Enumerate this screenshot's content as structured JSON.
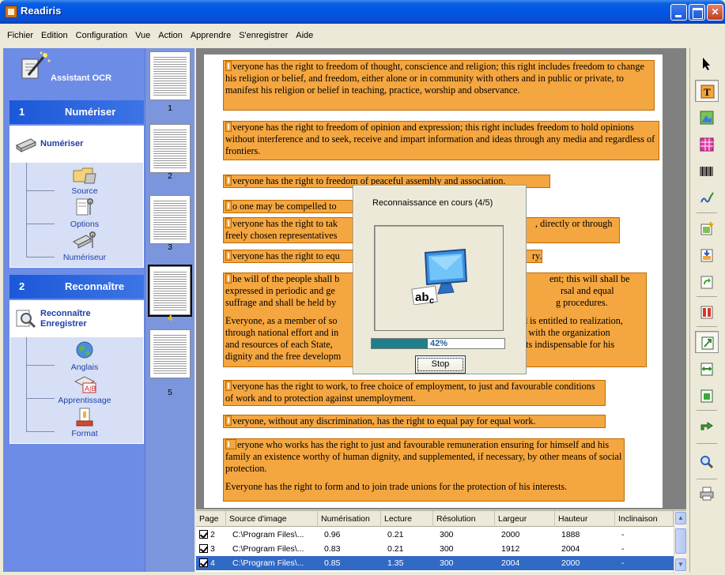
{
  "window": {
    "title": "Readiris"
  },
  "menu": [
    "Fichier",
    "Edition",
    "Configuration",
    "Vue",
    "Action",
    "Apprendre",
    "S'enregistrer",
    "Aide"
  ],
  "left_panel": {
    "brand_label": "Assistant OCR",
    "step1": {
      "number": "1",
      "label": "Numériser",
      "primary_action": "Numériser",
      "subitems": [
        "Source",
        "Options",
        "Numériseur"
      ]
    },
    "step2": {
      "number": "2",
      "label": "Reconnaître",
      "primary_action": "Reconnaître Enregistrer",
      "subitems": [
        "Anglais",
        "Apprentissage",
        "Format"
      ]
    }
  },
  "thumbnails": {
    "labels": [
      "1",
      "2",
      "3",
      "4",
      "5"
    ],
    "active_label": "4"
  },
  "document": {
    "blocks": [
      "veryone has the right to freedom of thought, conscience and religion; this right includes freedom to change his religion or belief, and freedom, either alone or in community with others and in public or private, to manifest his religion or belief in teaching, practice, worship and observance.",
      "veryone has the right to freedom of opinion and expression; this right includes freedom to hold opinions without interference and to seek, receive and impart information and ideas through any media and regardless of frontiers.",
      "veryone has the right to freedom of peaceful assembly and association.",
      "o one may be compelled to",
      "veryone has the right to tak",
      "freely chosen representatives",
      ", directly or through",
      "veryone has the right to equ",
      "ry.",
      "he will of the people shall b",
      "ent; this will shall be",
      "expressed in periodic and ge",
      "rsal and equal",
      "suffrage and shall be held by",
      "g procedures.",
      "Everyone, as a member of so",
      "d is entitled to realization,",
      "through national effort and in",
      "ance with the organization",
      "and resources of each State,",
      "hts indispensable for his",
      "dignity and the free developm",
      "veryone has the right to work, to free choice of employment, to just and favourable conditions of work and to protection against unemployment.",
      "veryone, without any discrimination, has the right to equal pay for equal work.",
      "eryone who works has the right to just and favourable remuneration ensuring for himself and his family an existence worthy of human dignity, and supplemented, if necessary, by other means of social protection.",
      "Everyone has the right to form and to join trade unions for the protection of his interests."
    ]
  },
  "dialog": {
    "title": "Reconnaissance en cours (4/5)",
    "progress_percent": 42,
    "progress_label": "42%",
    "stop_label": "Stop"
  },
  "table": {
    "columns": [
      "Page",
      "Source d'image",
      "Numérisation",
      "Lecture",
      "Résolution",
      "Largeur",
      "Hauteur",
      "Inclinaison"
    ],
    "rows": [
      [
        "2",
        "C:\\Program Files\\...",
        "0.96",
        "0.21",
        "300",
        "2000",
        "1888",
        "-"
      ],
      [
        "3",
        "C:\\Program Files\\...",
        "0.83",
        "0.21",
        "300",
        "1912",
        "2004",
        "-"
      ],
      [
        "4",
        "C:\\Program Files\\...",
        "0.85",
        "1.35",
        "300",
        "2004",
        "2000",
        "-"
      ]
    ],
    "selected_row": 2
  },
  "toolbar": {
    "tools": [
      "pointer-icon",
      "text-zone-icon",
      "image-zone-icon",
      "table-zone-icon",
      "barcode-zone-icon",
      "handwriting-zone-icon",
      "add-zone-icon",
      "insert-zone-icon",
      "link-zone-icon",
      "split-zone-icon",
      "resize-zone-icon",
      "width-zone-icon",
      "merge-zone-icon",
      "export-icon",
      "zoom-icon",
      "print-icon"
    ]
  },
  "colors": {
    "zone_orange": "#f4a640",
    "title_blue": "#0055e5",
    "panel_blue": "#6d8ce6",
    "progress_teal": "#1f7f8a"
  }
}
